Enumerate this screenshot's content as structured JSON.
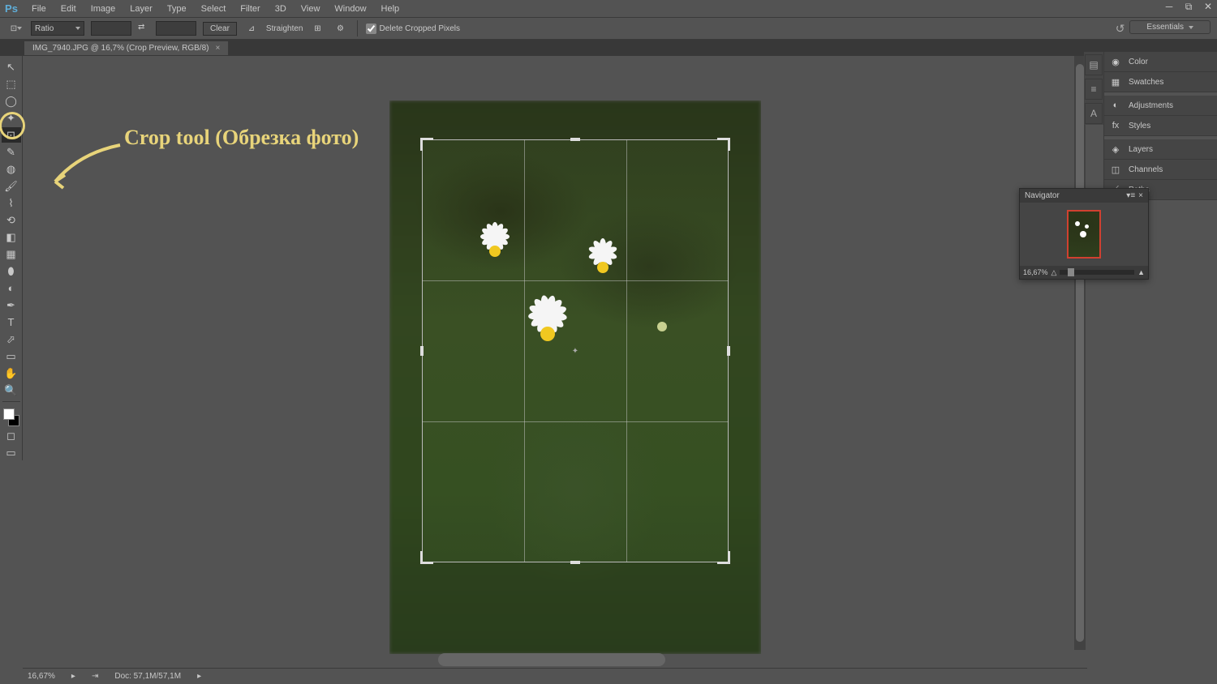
{
  "app_logo": "Ps",
  "menu": [
    "File",
    "Edit",
    "Image",
    "Layer",
    "Type",
    "Select",
    "Filter",
    "3D",
    "View",
    "Window",
    "Help"
  ],
  "options": {
    "ratio_mode": "Ratio",
    "clear_btn": "Clear",
    "straighten_btn": "Straighten",
    "delete_cropped": "Delete Cropped Pixels"
  },
  "workspace": "Essentials",
  "tab_title": "IMG_7940.JPG @ 16,7% (Crop Preview, RGB/8)",
  "annotation": "Crop tool (Обрезка фото)",
  "panels": {
    "color": "Color",
    "swatches": "Swatches",
    "adjustments": "Adjustments",
    "styles": "Styles",
    "layers": "Layers",
    "channels": "Channels",
    "paths": "Paths"
  },
  "navigator": {
    "title": "Navigator",
    "zoom": "16,67%"
  },
  "status": {
    "zoom": "16,67%",
    "doc": "Doc: 57,1M/57,1M"
  },
  "tools": {
    "move": "↖",
    "marquee": "⬚",
    "lasso": "◯",
    "wand": "✦",
    "crop": "⊡",
    "eyedropper": "✎",
    "heal": "◍",
    "brush": "🖌",
    "stamp": "⌇",
    "history": "⟲",
    "eraser": "◧",
    "gradient": "▦",
    "blur": "⬮",
    "dodge": "◐",
    "pen": "✒",
    "type": "T",
    "path": "⬀",
    "shape": "▭",
    "hand": "✋",
    "zoom": "🔍"
  }
}
